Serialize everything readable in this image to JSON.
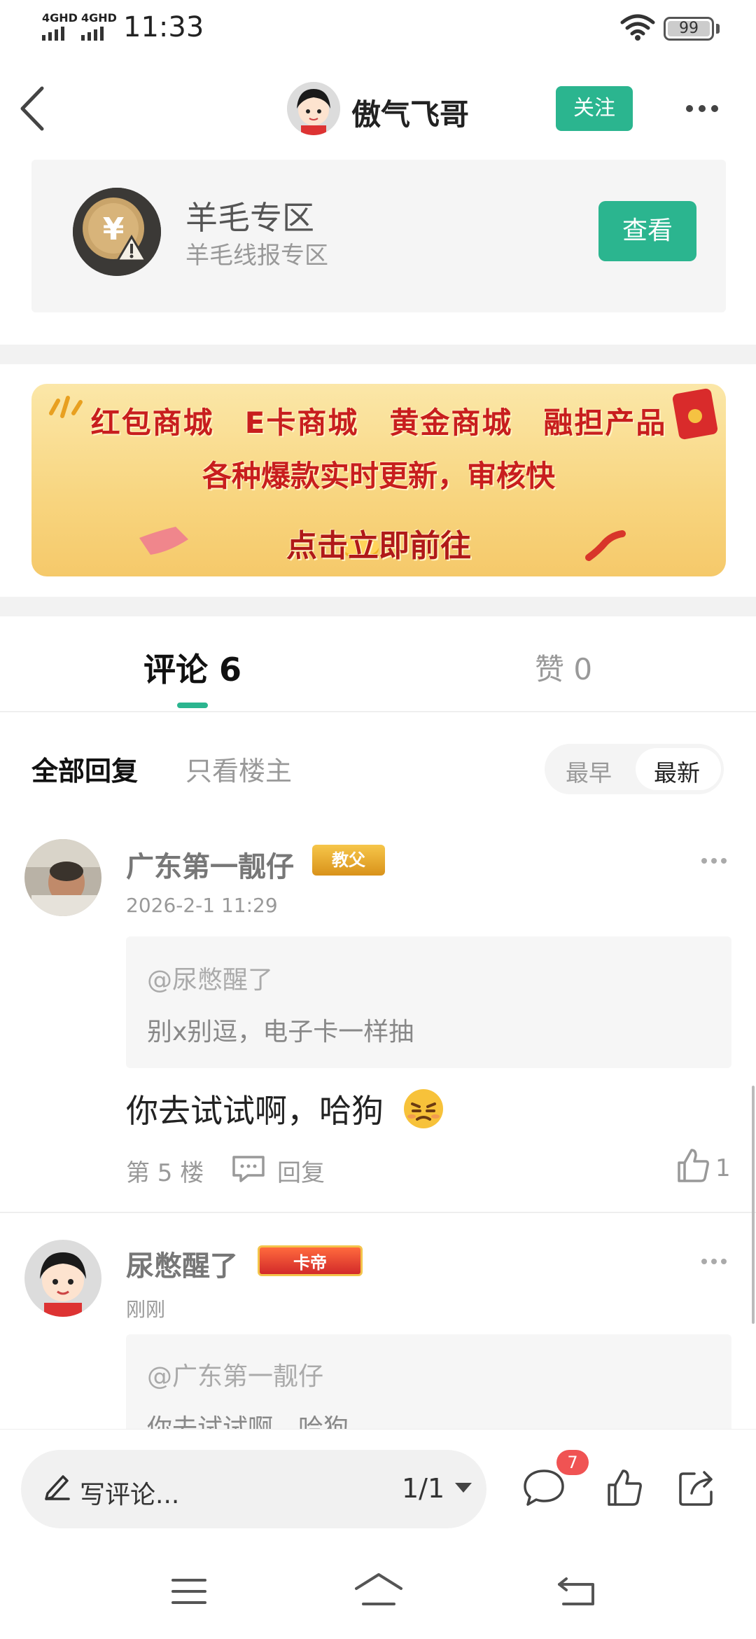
{
  "status_bar": {
    "net1": "4GHD",
    "net2": "4GHD",
    "time": "11:33",
    "battery": "99"
  },
  "header": {
    "author": "傲气飞哥",
    "follow_label": "关注"
  },
  "forum": {
    "name": "羊毛专区",
    "description": "羊毛线报专区",
    "view_label": "查看"
  },
  "banner": {
    "line1": "红包商城　E卡商城　黄金商城　融担产品",
    "line2": "各种爆款实时更新，审核快",
    "line3": "点击立即前往"
  },
  "tabs": {
    "comment": "评论 6",
    "like": "赞 0"
  },
  "filter": {
    "all": "全部回复",
    "op_only": "只看楼主",
    "sort_earliest": "最早",
    "sort_newest": "最新"
  },
  "comments": [
    {
      "user": "广东第一靓仔",
      "badge": "教父",
      "time": "2026-2-1 11:29",
      "quote_user": "@尿憋醒了",
      "quote_text": "别x别逗，电子卡一样抽",
      "body": "你去试试啊，哈狗",
      "floor": "第 5 楼",
      "reply_label": "回复",
      "likes": "1"
    },
    {
      "user": "尿憋醒了",
      "badge": "卡帝",
      "time": "刚刚",
      "quote_user": "@广东第一靓仔",
      "quote_text": "你去试试啊，哈狗"
    }
  ],
  "bottom_bar": {
    "placeholder": "写评论...",
    "page": "1/1",
    "comment_count": "7"
  },
  "colors": {
    "accent": "#2bb58f",
    "notification": "#f05353"
  }
}
